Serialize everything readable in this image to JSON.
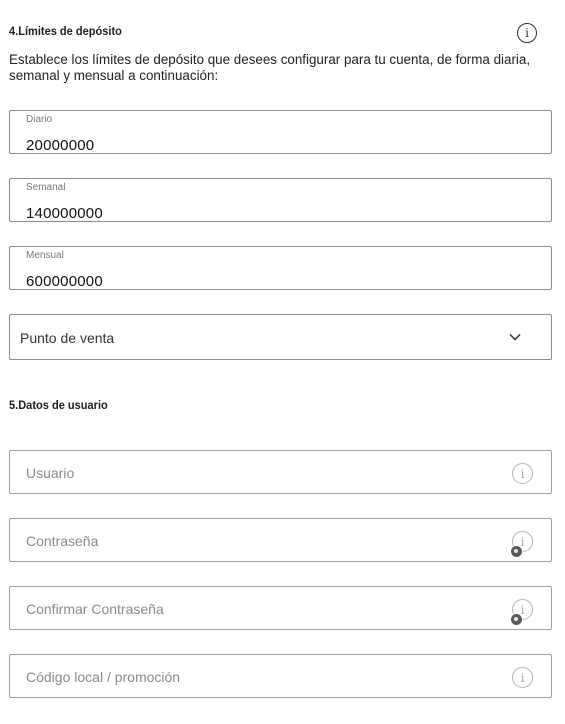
{
  "deposit_limits": {
    "title": "4.Límites de depósito",
    "info_icon": "info-icon",
    "description": "Establece los límites de depósito que desees configurar para tu cuenta, de forma diaria, semanal y mensual a continuación:",
    "daily": {
      "label": "Diario",
      "value": "20000000"
    },
    "weekly": {
      "label": "Semanal",
      "value": "140000000"
    },
    "monthly": {
      "label": "Mensual",
      "value": "600000000"
    },
    "point_of_sale": {
      "selected": "Punto de venta",
      "icon": "chevron-down-icon"
    }
  },
  "user_data": {
    "title": "5.Datos de usuario",
    "username": {
      "placeholder": "Usuario",
      "icon": "info-icon"
    },
    "password": {
      "placeholder": "Contraseña",
      "icon": "info-icon"
    },
    "confirm_password": {
      "placeholder": "Confirmar Contraseña",
      "icon": "info-icon"
    },
    "promo_code": {
      "placeholder": "Código local / promoción",
      "icon": "info-icon"
    }
  }
}
